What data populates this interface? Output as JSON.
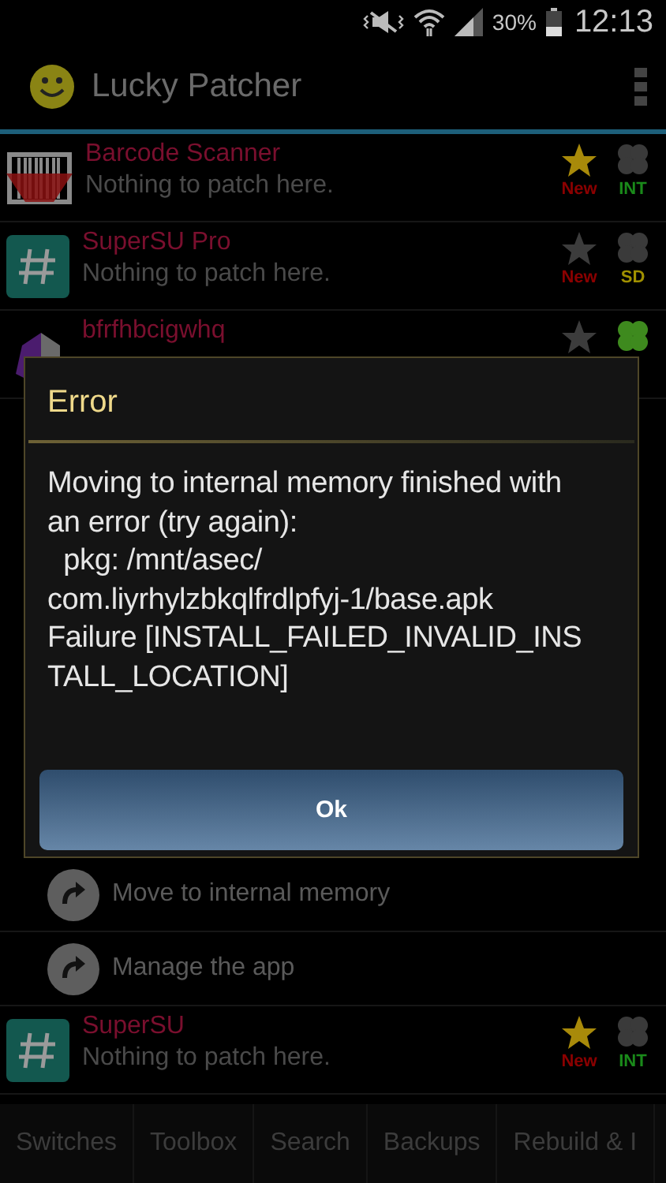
{
  "status_bar": {
    "battery": "30%",
    "time": "12:13"
  },
  "app_bar": {
    "title": "Lucky Patcher"
  },
  "apps": [
    {
      "kind": "barcode",
      "name": "Barcode Scanner",
      "subtitle": "Nothing to patch here.",
      "starred": true,
      "clover_green": false,
      "badges": [
        {
          "text": "New",
          "color": "#8b0000"
        },
        {
          "text": "INT",
          "color": "#1a8a1a"
        }
      ]
    },
    {
      "kind": "supersu",
      "name": "SuperSU Pro",
      "subtitle": "Nothing to patch here.",
      "starred": false,
      "clover_green": false,
      "badges": [
        {
          "text": "New",
          "color": "#8b0000"
        },
        {
          "text": "SD",
          "color": "#a09000"
        }
      ]
    },
    {
      "kind": "purple",
      "name": "bfrfhbcigwhq",
      "starred": false,
      "clover_green": true
    }
  ],
  "menu_items": [
    "Move to internal memory",
    "Manage the app"
  ],
  "apps_below": [
    {
      "kind": "supersu",
      "name": "SuperSU",
      "subtitle": "Nothing to patch here.",
      "starred": true,
      "clover_green": false,
      "badges": [
        {
          "text": "New",
          "color": "#8b0000"
        },
        {
          "text": "INT",
          "color": "#1a8a1a"
        }
      ]
    }
  ],
  "tabs": [
    "Switches",
    "Toolbox",
    "Search",
    "Backups",
    "Rebuild & I"
  ],
  "dialog": {
    "title": "Error",
    "message": "Moving to internal memory finished with an error (try again):\n  pkg: /mnt/asec/\ncom.liyrhylzbkqlfrdlpfyj-1/base.apk\nFailure [INSTALL_FAILED_INVALID_INS\nTALL_LOCATION]",
    "button": "Ok"
  }
}
